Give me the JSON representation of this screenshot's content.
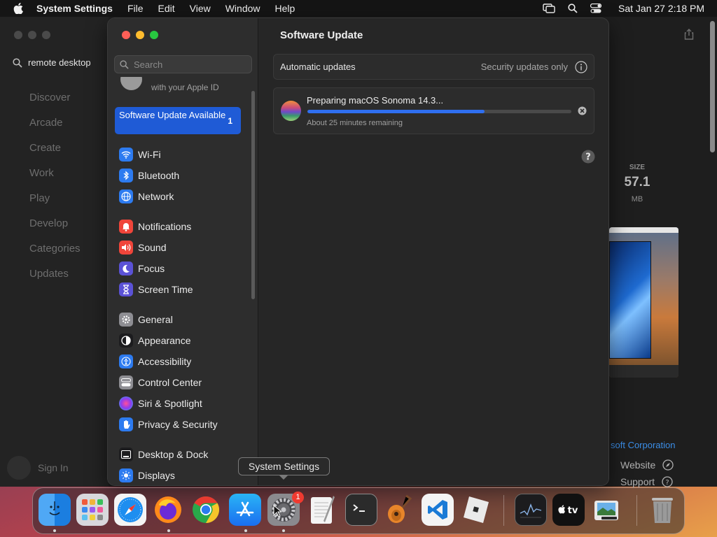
{
  "menubar": {
    "app_name": "System Settings",
    "menus": [
      "File",
      "Edit",
      "View",
      "Window",
      "Help"
    ],
    "clock": "Sat Jan 27  2:18 PM",
    "icons": [
      "apple-icon",
      "screen-mirroring-icon",
      "spotlight-search-icon",
      "control-center-icon"
    ]
  },
  "app_store": {
    "search_value": "remote desktop",
    "nav": [
      "Discover",
      "Arcade",
      "Create",
      "Work",
      "Play",
      "Develop",
      "Categories",
      "Updates"
    ],
    "sign_in": "Sign In",
    "size_label": "SIZE",
    "size_value": "57.1",
    "size_unit": "MB",
    "developer_fragment": "soft Corporation",
    "website": "Website",
    "support": "Support"
  },
  "settings": {
    "search_placeholder": "Search",
    "apple_id_text": "with your Apple ID",
    "update_item": {
      "label": "Software Update Available",
      "badge": "1"
    },
    "sidebar_items": [
      {
        "label": "Wi-Fi",
        "icon": "wifi-icon",
        "color": "#2d7bf0"
      },
      {
        "label": "Bluetooth",
        "icon": "bluetooth-icon",
        "color": "#2d7bf0"
      },
      {
        "label": "Network",
        "icon": "globe-icon",
        "color": "#2d7bf0"
      },
      {
        "label": "Notifications",
        "icon": "bell-icon",
        "color": "#f0453a"
      },
      {
        "label": "Sound",
        "icon": "speaker-icon",
        "color": "#f0453a"
      },
      {
        "label": "Focus",
        "icon": "moon-icon",
        "color": "#5b52d6"
      },
      {
        "label": "Screen Time",
        "icon": "hourglass-icon",
        "color": "#5b52d6"
      },
      {
        "label": "General",
        "icon": "gear-icon",
        "color": "#8e8e93"
      },
      {
        "label": "Appearance",
        "icon": "appearance-icon",
        "color": "#1c1c1e"
      },
      {
        "label": "Accessibility",
        "icon": "accessibility-icon",
        "color": "#2d7bf0"
      },
      {
        "label": "Control Center",
        "icon": "control-center-icon",
        "color": "#8e8e93"
      },
      {
        "label": "Siri & Spotlight",
        "icon": "siri-icon",
        "color": "#b044d8"
      },
      {
        "label": "Privacy & Security",
        "icon": "hand-icon",
        "color": "#2d7bf0"
      },
      {
        "label": "Desktop & Dock",
        "icon": "dock-icon",
        "color": "#1c1c1e"
      },
      {
        "label": "Displays",
        "icon": "sun-icon",
        "color": "#2d7bf0"
      }
    ],
    "main_title": "Software Update",
    "automatic_updates_label": "Automatic updates",
    "automatic_updates_value": "Security updates only",
    "progress_name": "Preparing macOS Sonoma 14.3...",
    "progress_fraction": 0.67,
    "progress_remaining": "About 25 minutes remaining"
  },
  "tooltip": "System Settings",
  "dock": {
    "apps": [
      "Finder",
      "Launchpad",
      "Safari",
      "Firefox",
      "Chrome",
      "App Store",
      "System Settings",
      "TextEdit",
      "Terminal",
      "GarageBand",
      "Visual Studio Code",
      "Roblox",
      "Activity Monitor",
      "Apple TV",
      "Preview",
      "Trash"
    ],
    "settings_badge": "1"
  },
  "colors": {
    "accent": "#1f5bd6",
    "progress_fill": "#2f6ff0",
    "close": "#ff5f57",
    "minimize": "#febc2e",
    "zoom": "#28c840"
  }
}
